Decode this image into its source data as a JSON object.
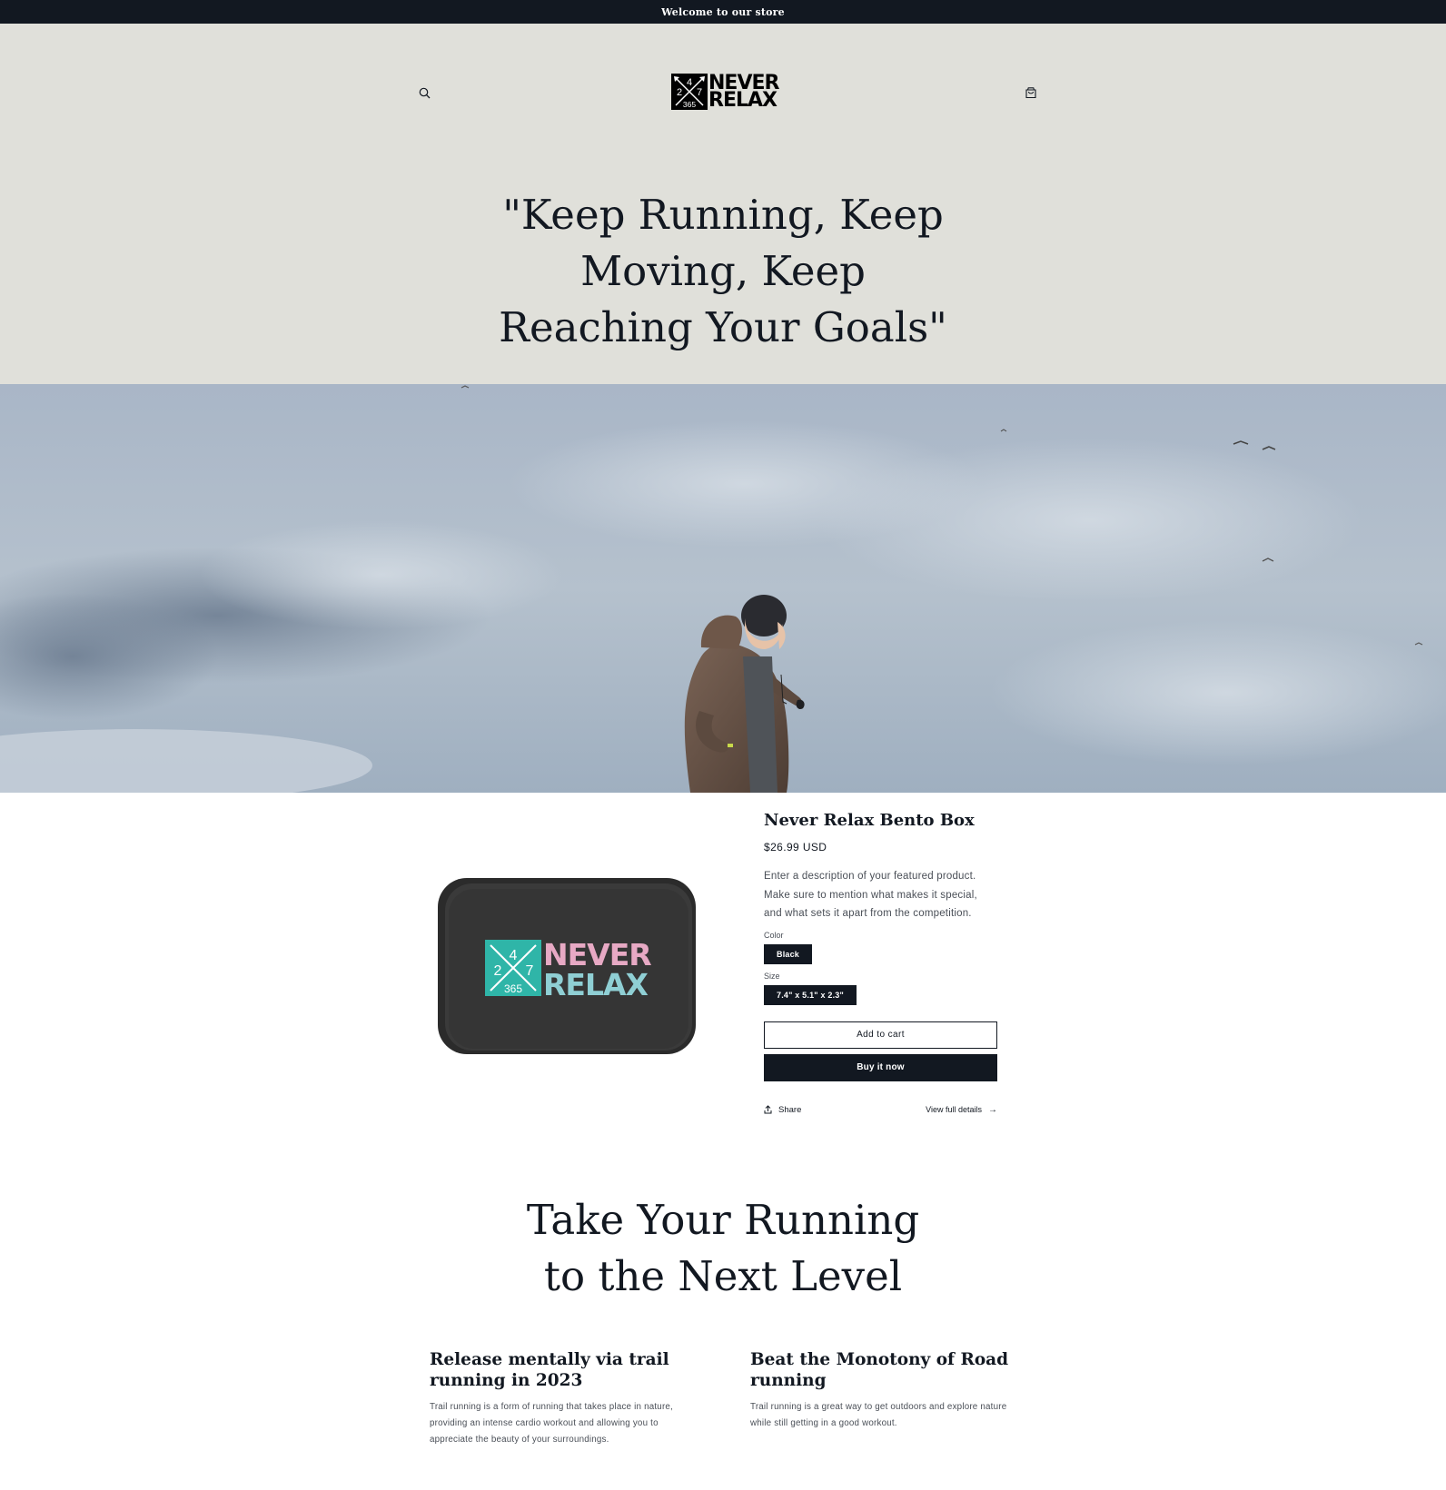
{
  "announcement": {
    "text": "Welcome to our store"
  },
  "header": {
    "logo": {
      "mark_text": [
        "4",
        "2",
        "7",
        "365"
      ],
      "word_lines": [
        "NEVER",
        "RELAX"
      ]
    },
    "search_icon": "search-icon",
    "cart_icon": "cart-icon"
  },
  "hero": {
    "quote_lines": [
      "\"Keep Running, Keep",
      "Moving, Keep",
      "Reaching Your Goals\""
    ]
  },
  "product": {
    "title": "Never Relax Bento Box",
    "price": "$26.99 USD",
    "description": "Enter a description of your featured product. Make sure to mention what makes it special, and what sets it apart from the competition.",
    "color_label": "Color",
    "color_value": "Black",
    "size_label": "Size",
    "size_value": "7.4\" x 5.1\" x 2.3\"",
    "add_to_cart": "Add to cart",
    "buy_now": "Buy it now",
    "share": "Share",
    "view_details": "View full details",
    "image_logo": {
      "mark_text": [
        "4",
        "2",
        "7",
        "365"
      ],
      "word_lines": [
        "NEVER",
        "RELAX"
      ]
    }
  },
  "features": {
    "heading_lines": [
      "Take Your Running",
      "to the Next Level"
    ],
    "columns": [
      {
        "title": "Release mentally via trail running in 2023",
        "text": "Trail running is a form of running that takes place in nature, providing an intense cardio workout and allowing you to appreciate the beauty of your surroundings."
      },
      {
        "title": "Beat the Monotony of Road running",
        "text": "Trail running is a great way to get outdoors and explore nature while still getting in a good workout."
      }
    ]
  },
  "colors": {
    "dark": "#121821",
    "header_bg": "#e0e0da",
    "teal": "#2fb5a8"
  }
}
